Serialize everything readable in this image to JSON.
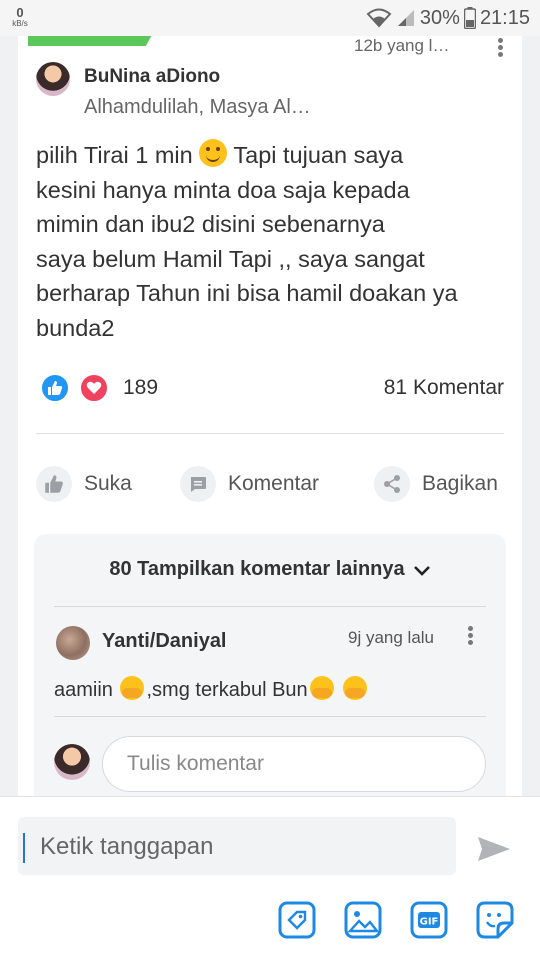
{
  "status_bar": {
    "speed_value": "0",
    "speed_unit": "kB/s",
    "battery": "30%",
    "time": "21:15"
  },
  "post": {
    "timestamp": "12b yang l…",
    "author": "BuNina aDiono",
    "subtitle": "Alhamdulilah, Masya Al…",
    "body_lines": [
      "pilih Tirai 1 min",
      "Tapi tujuan saya",
      "kesini hanya minta doa saja kepada",
      "mimin dan ibu2 disini sebenarnya",
      "saya belum Hamil Tapi ,, saya sangat",
      "berharap Tahun ini bisa hamil doakan ya",
      "bunda2"
    ],
    "reaction_count": "189",
    "comment_count": "81 Komentar"
  },
  "actions": {
    "like": "Suka",
    "comment": "Komentar",
    "share": "Bagikan"
  },
  "comments": {
    "more_label": "80 Tampilkan komentar lainnya",
    "items": [
      {
        "name": "Yanti/Daniyal",
        "time": "9j yang lalu",
        "text_prefix": "aamiin ",
        "text_mid": ",smg terkabul Bun"
      }
    ],
    "write_placeholder": "Tulis komentar"
  },
  "compose": {
    "placeholder": "Ketik tanggapan"
  },
  "colors": {
    "accent_blue": "#2196f3",
    "heart_red": "#f0415f",
    "badge_green": "#5cc85c"
  },
  "icons": {
    "toolbar": [
      "tag-icon",
      "image-icon",
      "gif-icon",
      "sticker-icon"
    ]
  }
}
